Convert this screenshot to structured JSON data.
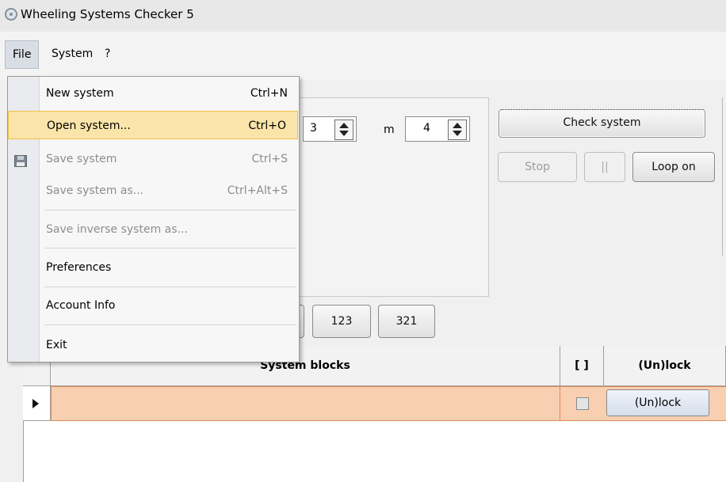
{
  "window": {
    "title": "Wheeling Systems Checker 5"
  },
  "menubar": {
    "file": "File",
    "system": "System",
    "help": "?"
  },
  "file_menu": {
    "items": [
      {
        "label": "New system",
        "shortcut": "Ctrl+N"
      },
      {
        "label": "Open system...",
        "shortcut": "Ctrl+O"
      },
      {
        "label": "Save system",
        "shortcut": "Ctrl+S"
      },
      {
        "label": "Save system as...",
        "shortcut": "Ctrl+Alt+S"
      },
      {
        "label": "Save inverse system as...",
        "shortcut": ""
      },
      {
        "label": "Preferences",
        "shortcut": ""
      },
      {
        "label": "Account Info",
        "shortcut": ""
      },
      {
        "label": "Exit",
        "shortcut": ""
      }
    ]
  },
  "params": {
    "n_value": "3",
    "m_label": "m",
    "m_value": "4"
  },
  "controls": {
    "check_system": "Check system",
    "stop": "Stop",
    "pause": "||",
    "loop_on": "Loop on",
    "btn_123": "123",
    "btn_321": "321"
  },
  "grid": {
    "columns": [
      "System blocks",
      "[ ]",
      "(Un)lock"
    ],
    "rows": [
      {
        "block": "",
        "checked": false,
        "lock_label": "(Un)lock"
      }
    ]
  },
  "colors": {
    "highlight_row": "#f8cfb1",
    "menu_hover": "#fbe4a9"
  }
}
